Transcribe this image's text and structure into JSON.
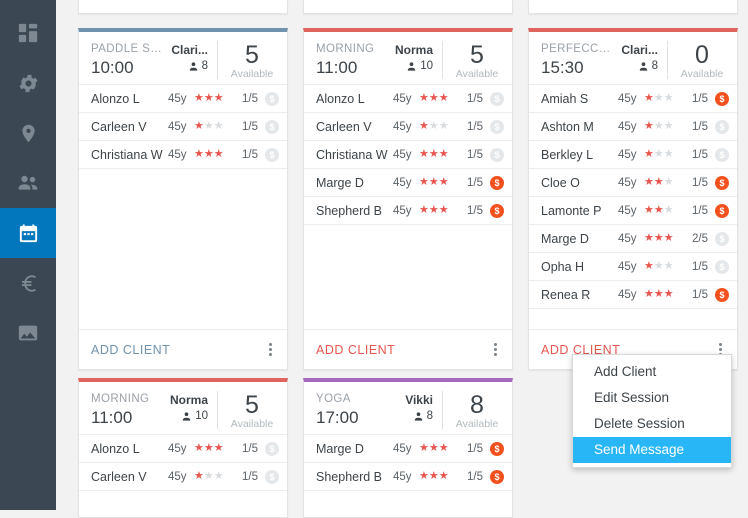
{
  "sidebar": {
    "items": [
      {
        "name": "dashboard-icon",
        "label": "Dashboard",
        "active": false
      },
      {
        "name": "settings-gear-icon",
        "label": "Settings",
        "active": false
      },
      {
        "name": "location-pin-icon",
        "label": "Locations",
        "active": false
      },
      {
        "name": "people-icon",
        "label": "Clients",
        "active": false
      },
      {
        "name": "calendar-icon",
        "label": "Calendar",
        "active": true
      },
      {
        "name": "euro-icon",
        "label": "Billing",
        "active": false
      },
      {
        "name": "image-icon",
        "label": "Gallery",
        "active": false
      }
    ]
  },
  "labels": {
    "available": "Available",
    "add_client": "ADD CLIENT",
    "age_suffix": "45y"
  },
  "colors": {
    "accent_blue": "#0277bd",
    "session_blue": "#6f92ae",
    "session_red": "#e0645e",
    "session_purple": "#a569bd",
    "paid_orange": "#f4511e",
    "unpaid_gray": "#e5e8ea",
    "star_on": "#e8564f",
    "star_off": "#d9dcde",
    "menu_highlight": "#29b6f6",
    "sidebar_bg": "#3b4752"
  },
  "cards": [
    {
      "id": "card-paddle-surf",
      "accent": "#6f92ae",
      "name": "PADDLE SURF",
      "time": "10:00",
      "coach": "Clari...",
      "capacity": "8",
      "available": "5",
      "available_label": "Available",
      "add_client_label": "ADD CLIENT",
      "add_client_style": "blue",
      "clients": [
        {
          "name": "Alonzo L",
          "age": "45y",
          "stars": 3,
          "count": "1/5",
          "paid": false
        },
        {
          "name": "Carleen V",
          "age": "45y",
          "stars": 1,
          "count": "1/5",
          "paid": false
        },
        {
          "name": "Christiana W",
          "age": "45y",
          "stars": 3,
          "count": "1/5",
          "paid": false
        }
      ]
    },
    {
      "id": "card-morning-11-a",
      "accent": "#e0645e",
      "name": "MORNING",
      "time": "11:00",
      "coach": "Norma",
      "capacity": "10",
      "available": "5",
      "available_label": "Available",
      "add_client_label": "ADD CLIENT",
      "add_client_style": "red",
      "clients": [
        {
          "name": "Alonzo L",
          "age": "45y",
          "stars": 3,
          "count": "1/5",
          "paid": false
        },
        {
          "name": "Carleen V",
          "age": "45y",
          "stars": 1,
          "count": "1/5",
          "paid": false
        },
        {
          "name": "Christiana W",
          "age": "45y",
          "stars": 3,
          "count": "1/5",
          "paid": false
        },
        {
          "name": "Marge D",
          "age": "45y",
          "stars": 3,
          "count": "1/5",
          "paid": true
        },
        {
          "name": "Shepherd B",
          "age": "45y",
          "stars": 3,
          "count": "1/5",
          "paid": true
        }
      ]
    },
    {
      "id": "card-perfeccion",
      "accent": "#e0645e",
      "name": "PERFECCION. ...",
      "time": "15:30",
      "coach": "Clari...",
      "capacity": "8",
      "available": "0",
      "available_label": "Available",
      "add_client_label": "ADD CLIENT",
      "add_client_style": "red",
      "clients": [
        {
          "name": "Amiah S",
          "age": "45y",
          "stars": 1,
          "count": "1/5",
          "paid": true
        },
        {
          "name": "Ashton M",
          "age": "45y",
          "stars": 1,
          "count": "1/5",
          "paid": false
        },
        {
          "name": "Berkley L",
          "age": "45y",
          "stars": 1,
          "count": "1/5",
          "paid": false
        },
        {
          "name": "Cloe O",
          "age": "45y",
          "stars": 2,
          "count": "1/5",
          "paid": true
        },
        {
          "name": "Lamonte P",
          "age": "45y",
          "stars": 2,
          "count": "1/5",
          "paid": true
        },
        {
          "name": "Marge D",
          "age": "45y",
          "stars": 3,
          "count": "2/5",
          "paid": false
        },
        {
          "name": "Opha H",
          "age": "45y",
          "stars": 1,
          "count": "1/5",
          "paid": false
        },
        {
          "name": "Renea R",
          "age": "45y",
          "stars": 3,
          "count": "1/5",
          "paid": true
        }
      ]
    },
    {
      "id": "card-morning-11-b",
      "accent": "#e0645e",
      "name": "MORNING",
      "time": "11:00",
      "coach": "Norma",
      "capacity": "10",
      "available": "5",
      "available_label": "Available",
      "add_client_label": "ADD CLIENT",
      "add_client_style": "red",
      "clients": [
        {
          "name": "Alonzo L",
          "age": "45y",
          "stars": 3,
          "count": "1/5",
          "paid": false
        },
        {
          "name": "Carleen V",
          "age": "45y",
          "stars": 1,
          "count": "1/5",
          "paid": false
        }
      ]
    },
    {
      "id": "card-yoga",
      "accent": "#a569bd",
      "name": "YOGA",
      "time": "17:00",
      "coach": "Vikki",
      "capacity": "8",
      "available": "8",
      "available_label": "Available",
      "add_client_label": "ADD CLIENT",
      "add_client_style": "red",
      "clients": [
        {
          "name": "Marge D",
          "age": "45y",
          "stars": 3,
          "count": "1/5",
          "paid": true
        },
        {
          "name": "Shepherd B",
          "age": "45y",
          "stars": 3,
          "count": "1/5",
          "paid": true
        }
      ]
    }
  ],
  "context_menu": {
    "items": [
      {
        "label": "Add Client",
        "selected": false
      },
      {
        "label": "Edit  Session",
        "selected": false
      },
      {
        "label": "Delete Session",
        "selected": false
      },
      {
        "label": "Send Message",
        "selected": true
      }
    ]
  }
}
